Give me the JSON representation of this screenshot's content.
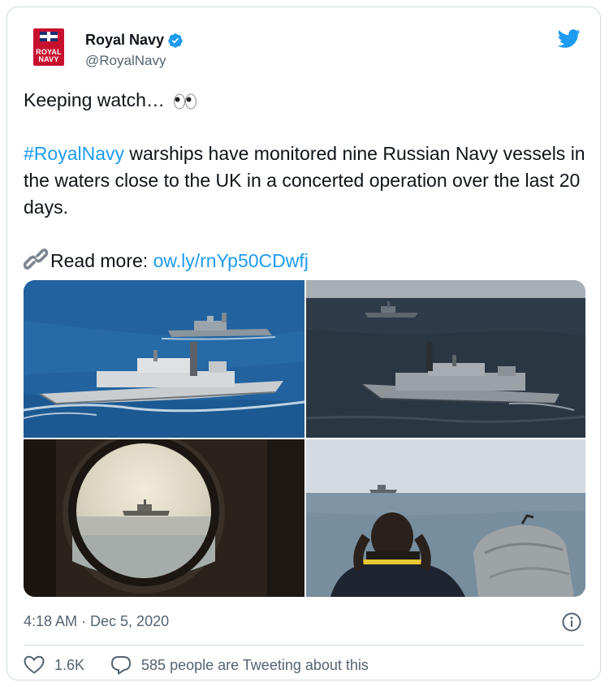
{
  "account": {
    "display_name": "Royal Navy",
    "handle": "@RoyalNavy",
    "avatar_text_line1": "ROYAL",
    "avatar_text_line2": "NAVY"
  },
  "tweet": {
    "line1": "Keeping watch…",
    "hashtag": "#RoyalNavy",
    "body": " warships have monitored nine Russian Navy vessels in the waters close to the UK in a concerted operation over the last 20 days.",
    "read_more_label": "Read more: ",
    "read_more_link": "ow.ly/rnYp50CDwfj"
  },
  "meta": {
    "timestamp": "4:18 AM · Dec 5, 2020"
  },
  "actions": {
    "likes": "1.6K",
    "replies_label": "585 people are Tweeting about this"
  },
  "colors": {
    "accent": "#1d9bf0",
    "text": "#0f1419",
    "muted": "#536471",
    "border": "#cfd9de"
  },
  "icons": [
    "verified-badge-icon",
    "twitter-bird-icon",
    "eyes-emoji-icon",
    "link-emoji-icon",
    "info-icon",
    "heart-icon",
    "reply-bubble-icon"
  ]
}
